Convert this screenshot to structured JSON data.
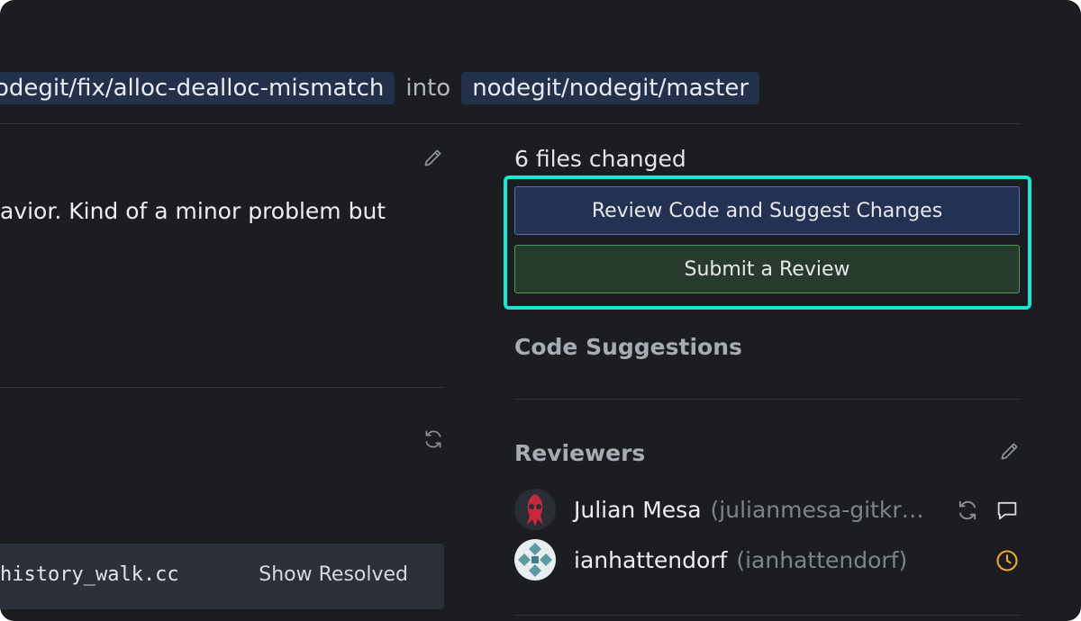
{
  "branches": {
    "source": "odegit/fix/alloc-dealloc-mismatch",
    "connector": "into",
    "target": "nodegit/nodegit/master"
  },
  "description": {
    "text": "avior. Kind of a minor problem but"
  },
  "file": {
    "name": "history_walk.cc",
    "show_resolved_label": "Show Resolved"
  },
  "sidebar": {
    "files_changed": "6 files changed",
    "review_button_label": "Review Code and Suggest Changes",
    "submit_button_label": "Submit a Review",
    "code_suggestions_title": "Code Suggestions",
    "reviewers_title": "Reviewers",
    "reviewers": [
      {
        "name": "Julian Mesa",
        "handle": "(julianmesa-gitkr…",
        "status_icons": [
          "refresh-icon",
          "comment-icon"
        ]
      },
      {
        "name": "ianhattendorf",
        "handle": "(ianhattendorf)",
        "status_icons": [
          "clock-icon"
        ]
      }
    ]
  },
  "colors": {
    "background": "#1c1d21",
    "highlight": "#19e7cf",
    "review_button": "#233252",
    "submit_button": "#263b2b",
    "pending": "#f0a830"
  }
}
